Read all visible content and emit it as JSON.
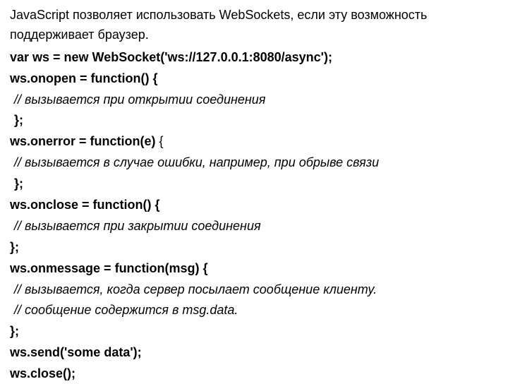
{
  "intro": "JavaScript позволяет использовать WebSockets, если эту возможность поддерживает браузер.",
  "lines": {
    "l1": "var ws = new WebSocket('ws://127.0.0.1:8080/async');",
    "l2": "ws.onopen = function() {",
    "l3": "// вызывается при открытии соединения",
    "l4": "};",
    "l5a": "ws.onerror = function(e) ",
    "l5b": "{",
    "l6": "// вызывается в случае ошибки, например, при обрыве связи",
    "l7": "};",
    "l8": "ws.onclose = function() {",
    "l9": "// вызывается при закрытии соединения",
    "l10": "};",
    "l11": "ws.onmessage = function(msg) {",
    "l12": "// вызывается, когда сервер посылает сообщение клиенту.",
    "l13": "// сообщение содержится в msg.data.",
    "l14": "};",
    "l15": "ws.send('some data');",
    "l16": "ws.close();"
  }
}
